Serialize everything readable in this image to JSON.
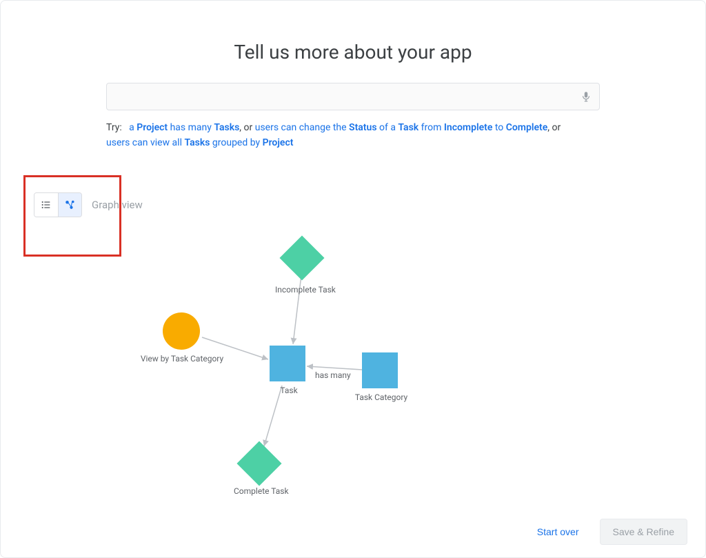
{
  "header": {
    "title": "Tell us more about your app"
  },
  "search": {
    "value": "",
    "placeholder": ""
  },
  "suggestions": {
    "try_label": "Try:",
    "link1_pre": "a ",
    "link1_kw1": "Project",
    "link1_mid": " has many ",
    "link1_kw2": "Tasks",
    "sep1": ", or ",
    "link2_pre": "users can change the ",
    "link2_kw1": "Status",
    "link2_mid1": " of a ",
    "link2_kw2": "Task",
    "link2_mid2": " from ",
    "link2_kw3": "Incomplete",
    "link2_mid3": " to ",
    "link2_kw4": "Complete",
    "sep2": ", or ",
    "link3_pre": "users can view all ",
    "link3_kw1": "Tasks",
    "link3_mid": " grouped by ",
    "link3_kw2": "Project"
  },
  "view": {
    "current_label": "Graph view"
  },
  "graph": {
    "nodes": {
      "incomplete": "Incomplete Task",
      "task": "Task",
      "category": "Task Category",
      "viewby": "View by Task Category",
      "complete": "Complete Task"
    },
    "edge_label": "has many"
  },
  "footer": {
    "start_over": "Start over",
    "save_refine": "Save & Refine"
  }
}
